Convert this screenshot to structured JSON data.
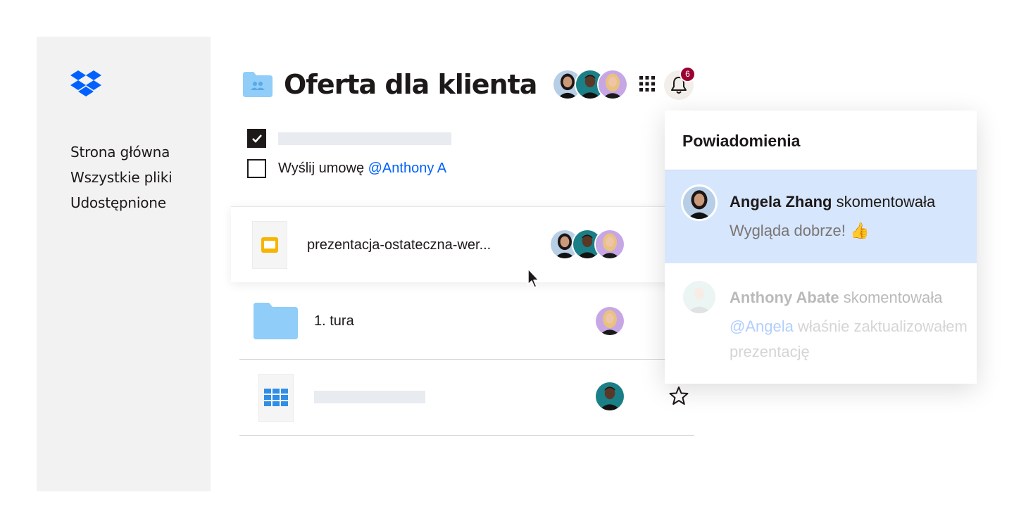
{
  "sidebar": {
    "logo": "dropbox-logo-icon",
    "nav": [
      "Strona główna",
      "Wszystkie pliki",
      "Udostępnione"
    ]
  },
  "header": {
    "title": "Oferta dla klienta",
    "folder_icon": "shared-folder-icon",
    "notification_count": "6"
  },
  "tasks": [
    {
      "checked": true,
      "text": "",
      "mention": ""
    },
    {
      "checked": false,
      "text": "Wyślij umowę ",
      "mention": "@Anthony A"
    }
  ],
  "files": [
    {
      "name": "prezentacja-ostateczna-wer...",
      "icon": "slides-icon"
    },
    {
      "name": "1. tura",
      "icon": "folder-icon"
    },
    {
      "name": "",
      "icon": "spreadsheet-icon"
    }
  ],
  "notifications": {
    "title": "Powiadomienia",
    "items": [
      {
        "author": "Angela Zhang",
        "action": " skomentowała",
        "message": "Wygląda dobrze! 👍"
      },
      {
        "author": "Anthony Abate",
        "action": " skomentowała",
        "mention": "@Angela",
        "message": " właśnie zaktualizowałem prezentację"
      }
    ]
  },
  "colors": {
    "accent": "#0061fe",
    "sidebar_bg": "#f2f2f2",
    "badge": "#9b0032",
    "highlight": "#d6e6fd",
    "folder": "#90cdf9"
  }
}
